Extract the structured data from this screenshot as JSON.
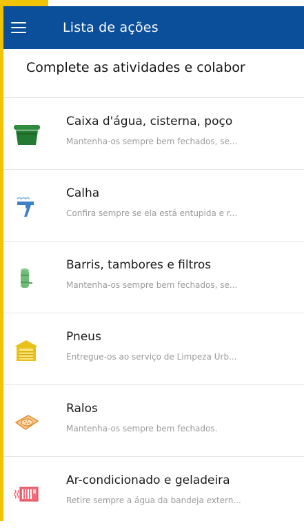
{
  "colors": {
    "appbar": "#0b4e9a",
    "accent": "#f2c300"
  },
  "header": {
    "title": "Lista de ações",
    "menu_icon": "menu-icon"
  },
  "subtitle": "Complete as atividades e colabor",
  "items": [
    {
      "title": "Caixa d'água, cisterna, poço",
      "desc": "Mantenha-os sempre bem fechados, se...",
      "icon": "water-tank-icon"
    },
    {
      "title": "Calha",
      "desc": "Confira sempre se ela está entupida e r...",
      "icon": "gutter-icon"
    },
    {
      "title": "Barris, tambores e filtros",
      "desc": "Mantenha-os sempre bem fechados, se...",
      "icon": "barrel-icon"
    },
    {
      "title": "Pneus",
      "desc": "Entregue-os ao serviço de Limpeza Urb...",
      "icon": "tire-storage-icon"
    },
    {
      "title": "Ralos",
      "desc": "Mantenha-os sempre bem fechados.",
      "icon": "drain-icon"
    },
    {
      "title": "Ar-condicionado e geladeira",
      "desc": "Retire sempre a água da bandeja extern...",
      "icon": "air-conditioner-icon"
    }
  ]
}
